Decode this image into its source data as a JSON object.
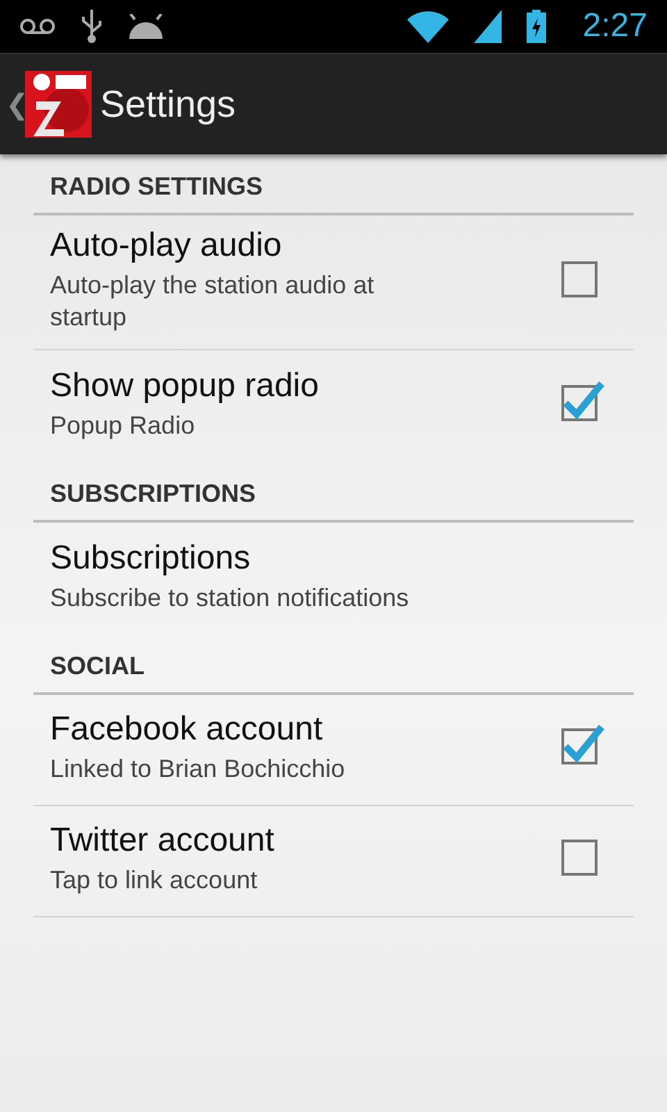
{
  "status_bar": {
    "time": "2:27"
  },
  "action_bar": {
    "back": "❮",
    "title": "Settings"
  },
  "sections": [
    {
      "header": "RADIO SETTINGS",
      "items": [
        {
          "kind": "checkbox",
          "title": "Auto-play audio",
          "summary": "Auto-play the station audio at startup",
          "checked": false
        },
        {
          "kind": "checkbox",
          "title": "Show popup radio",
          "summary": "Popup Radio",
          "checked": true
        }
      ]
    },
    {
      "header": "SUBSCRIPTIONS",
      "items": [
        {
          "kind": "link",
          "title": "Subscriptions",
          "summary": "Subscribe to station notifications"
        }
      ]
    },
    {
      "header": "SOCIAL",
      "items": [
        {
          "kind": "checkbox",
          "title": "Facebook account",
          "summary": "Linked to Brian Bochicchio",
          "checked": true
        },
        {
          "kind": "checkbox",
          "title": "Twitter account",
          "summary": "Tap to link account",
          "checked": false
        }
      ]
    }
  ]
}
